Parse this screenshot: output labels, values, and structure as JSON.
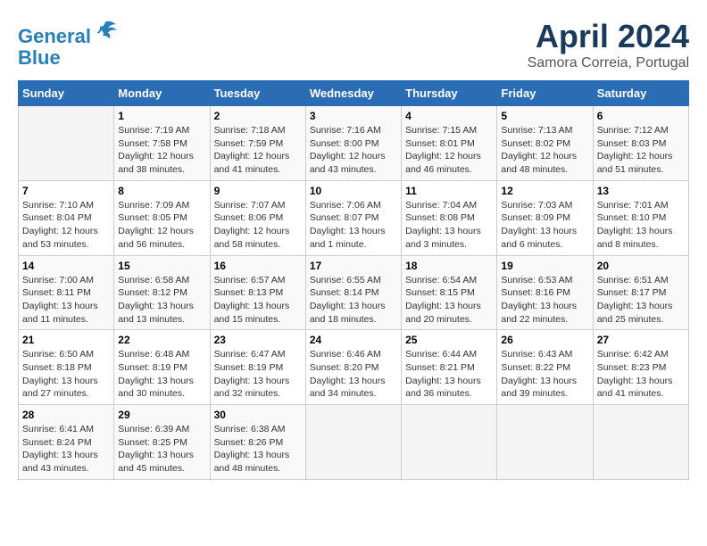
{
  "header": {
    "logo_line1": "General",
    "logo_line2": "Blue",
    "title": "April 2024",
    "subtitle": "Samora Correia, Portugal"
  },
  "calendar": {
    "days_of_week": [
      "Sunday",
      "Monday",
      "Tuesday",
      "Wednesday",
      "Thursday",
      "Friday",
      "Saturday"
    ],
    "weeks": [
      [
        {
          "day": "",
          "info": ""
        },
        {
          "day": "1",
          "info": "Sunrise: 7:19 AM\nSunset: 7:58 PM\nDaylight: 12 hours\nand 38 minutes."
        },
        {
          "day": "2",
          "info": "Sunrise: 7:18 AM\nSunset: 7:59 PM\nDaylight: 12 hours\nand 41 minutes."
        },
        {
          "day": "3",
          "info": "Sunrise: 7:16 AM\nSunset: 8:00 PM\nDaylight: 12 hours\nand 43 minutes."
        },
        {
          "day": "4",
          "info": "Sunrise: 7:15 AM\nSunset: 8:01 PM\nDaylight: 12 hours\nand 46 minutes."
        },
        {
          "day": "5",
          "info": "Sunrise: 7:13 AM\nSunset: 8:02 PM\nDaylight: 12 hours\nand 48 minutes."
        },
        {
          "day": "6",
          "info": "Sunrise: 7:12 AM\nSunset: 8:03 PM\nDaylight: 12 hours\nand 51 minutes."
        }
      ],
      [
        {
          "day": "7",
          "info": "Sunrise: 7:10 AM\nSunset: 8:04 PM\nDaylight: 12 hours\nand 53 minutes."
        },
        {
          "day": "8",
          "info": "Sunrise: 7:09 AM\nSunset: 8:05 PM\nDaylight: 12 hours\nand 56 minutes."
        },
        {
          "day": "9",
          "info": "Sunrise: 7:07 AM\nSunset: 8:06 PM\nDaylight: 12 hours\nand 58 minutes."
        },
        {
          "day": "10",
          "info": "Sunrise: 7:06 AM\nSunset: 8:07 PM\nDaylight: 13 hours\nand 1 minute."
        },
        {
          "day": "11",
          "info": "Sunrise: 7:04 AM\nSunset: 8:08 PM\nDaylight: 13 hours\nand 3 minutes."
        },
        {
          "day": "12",
          "info": "Sunrise: 7:03 AM\nSunset: 8:09 PM\nDaylight: 13 hours\nand 6 minutes."
        },
        {
          "day": "13",
          "info": "Sunrise: 7:01 AM\nSunset: 8:10 PM\nDaylight: 13 hours\nand 8 minutes."
        }
      ],
      [
        {
          "day": "14",
          "info": "Sunrise: 7:00 AM\nSunset: 8:11 PM\nDaylight: 13 hours\nand 11 minutes."
        },
        {
          "day": "15",
          "info": "Sunrise: 6:58 AM\nSunset: 8:12 PM\nDaylight: 13 hours\nand 13 minutes."
        },
        {
          "day": "16",
          "info": "Sunrise: 6:57 AM\nSunset: 8:13 PM\nDaylight: 13 hours\nand 15 minutes."
        },
        {
          "day": "17",
          "info": "Sunrise: 6:55 AM\nSunset: 8:14 PM\nDaylight: 13 hours\nand 18 minutes."
        },
        {
          "day": "18",
          "info": "Sunrise: 6:54 AM\nSunset: 8:15 PM\nDaylight: 13 hours\nand 20 minutes."
        },
        {
          "day": "19",
          "info": "Sunrise: 6:53 AM\nSunset: 8:16 PM\nDaylight: 13 hours\nand 22 minutes."
        },
        {
          "day": "20",
          "info": "Sunrise: 6:51 AM\nSunset: 8:17 PM\nDaylight: 13 hours\nand 25 minutes."
        }
      ],
      [
        {
          "day": "21",
          "info": "Sunrise: 6:50 AM\nSunset: 8:18 PM\nDaylight: 13 hours\nand 27 minutes."
        },
        {
          "day": "22",
          "info": "Sunrise: 6:48 AM\nSunset: 8:19 PM\nDaylight: 13 hours\nand 30 minutes."
        },
        {
          "day": "23",
          "info": "Sunrise: 6:47 AM\nSunset: 8:19 PM\nDaylight: 13 hours\nand 32 minutes."
        },
        {
          "day": "24",
          "info": "Sunrise: 6:46 AM\nSunset: 8:20 PM\nDaylight: 13 hours\nand 34 minutes."
        },
        {
          "day": "25",
          "info": "Sunrise: 6:44 AM\nSunset: 8:21 PM\nDaylight: 13 hours\nand 36 minutes."
        },
        {
          "day": "26",
          "info": "Sunrise: 6:43 AM\nSunset: 8:22 PM\nDaylight: 13 hours\nand 39 minutes."
        },
        {
          "day": "27",
          "info": "Sunrise: 6:42 AM\nSunset: 8:23 PM\nDaylight: 13 hours\nand 41 minutes."
        }
      ],
      [
        {
          "day": "28",
          "info": "Sunrise: 6:41 AM\nSunset: 8:24 PM\nDaylight: 13 hours\nand 43 minutes."
        },
        {
          "day": "29",
          "info": "Sunrise: 6:39 AM\nSunset: 8:25 PM\nDaylight: 13 hours\nand 45 minutes."
        },
        {
          "day": "30",
          "info": "Sunrise: 6:38 AM\nSunset: 8:26 PM\nDaylight: 13 hours\nand 48 minutes."
        },
        {
          "day": "",
          "info": ""
        },
        {
          "day": "",
          "info": ""
        },
        {
          "day": "",
          "info": ""
        },
        {
          "day": "",
          "info": ""
        }
      ]
    ]
  }
}
